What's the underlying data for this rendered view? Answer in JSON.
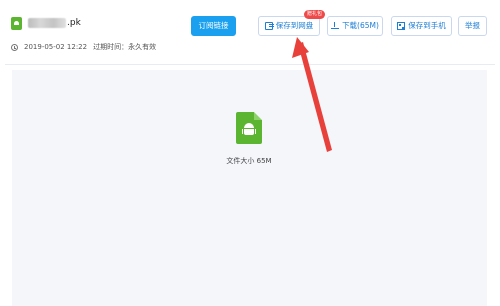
{
  "file": {
    "name_suffix": ".pk",
    "upload_time": "2019-05-02 12:22",
    "expiry_label": "过期时间：永久有效"
  },
  "toolbar": {
    "subscribe_label": "订阅链接",
    "save_label": "保存到网盘",
    "save_badge": "赠礼包",
    "download_label": "下载(65M)",
    "phone_label": "保存到手机",
    "report_label": "举报"
  },
  "preview": {
    "file_size": "文件大小 65M"
  },
  "colors": {
    "primary": "#1aa0ee",
    "link": "#1c7ed6",
    "apk_green": "#5cb531",
    "annotation_red": "#e8413c",
    "badge_red": "#ef4a4a"
  },
  "icons": {
    "file_icon": "android-apk-icon",
    "clock": "clock-icon",
    "save": "save-to-cloud-icon",
    "download": "download-icon",
    "phone": "qr-code-icon"
  }
}
